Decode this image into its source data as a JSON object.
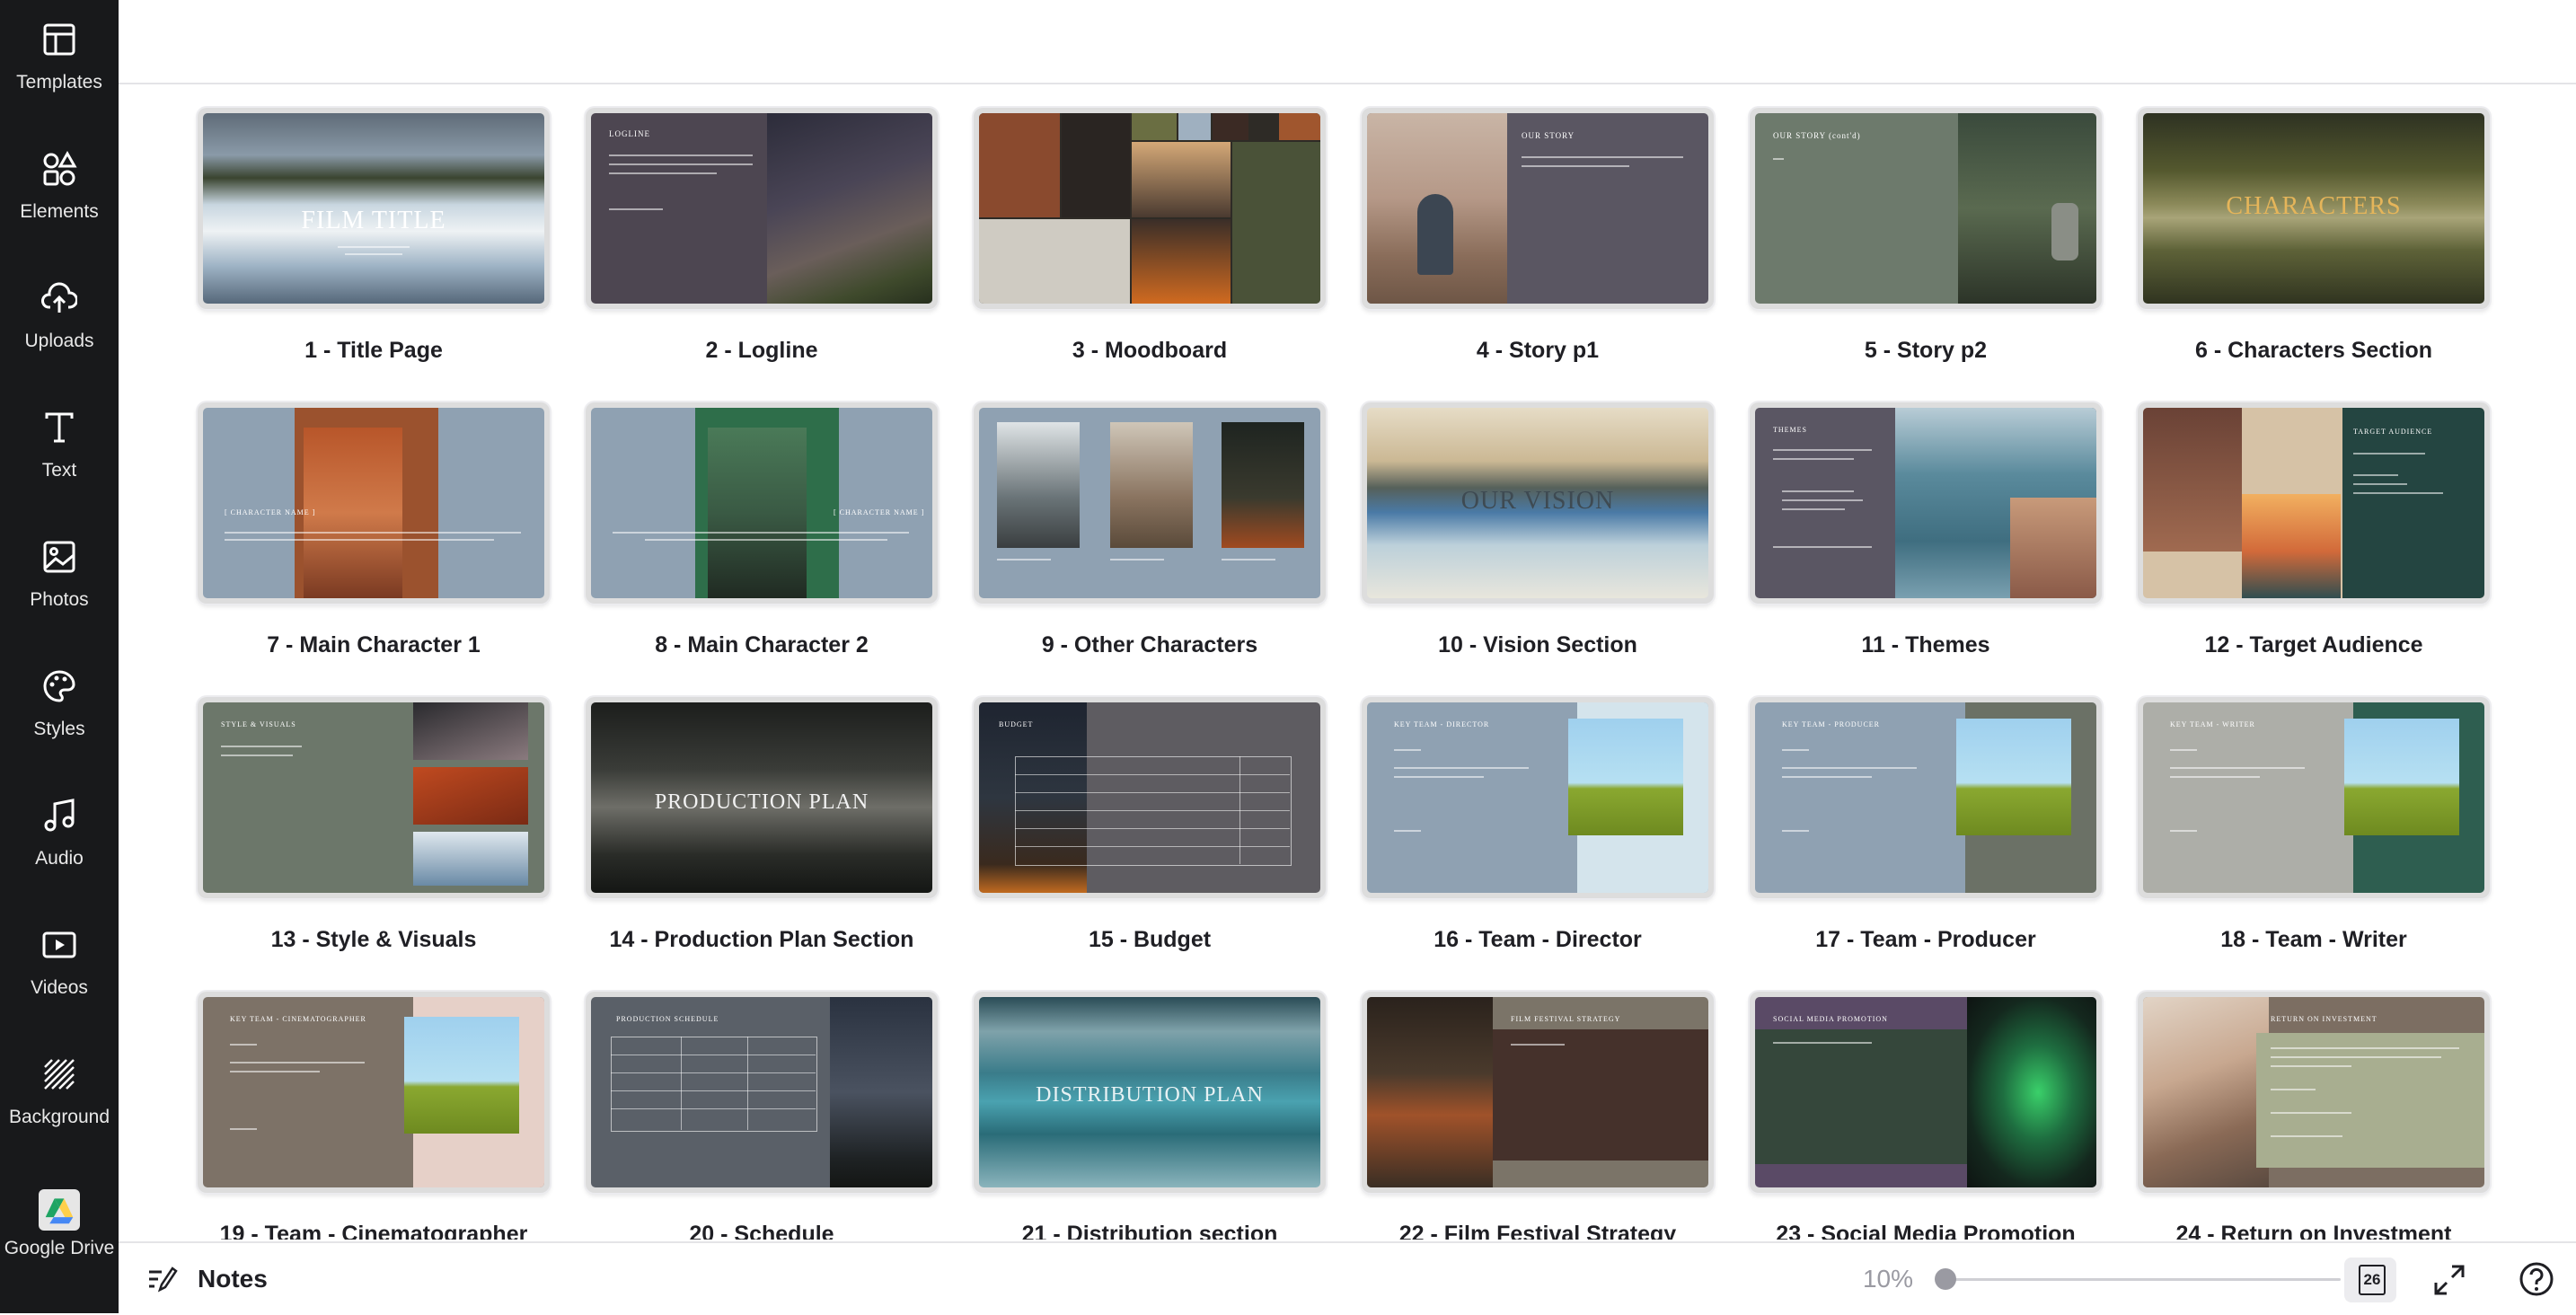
{
  "sidebar": {
    "items": [
      {
        "label": "Templates",
        "icon": "templates-icon"
      },
      {
        "label": "Elements",
        "icon": "elements-icon"
      },
      {
        "label": "Uploads",
        "icon": "upload-icon"
      },
      {
        "label": "Text",
        "icon": "text-icon"
      },
      {
        "label": "Photos",
        "icon": "photos-icon"
      },
      {
        "label": "Styles",
        "icon": "palette-icon"
      },
      {
        "label": "Audio",
        "icon": "music-note-icon"
      },
      {
        "label": "Videos",
        "icon": "video-icon"
      },
      {
        "label": "Background",
        "icon": "background-pattern-icon"
      },
      {
        "label": "Google Drive",
        "icon": "google-drive-icon"
      }
    ]
  },
  "pages": [
    {
      "label": "1 - Title Page",
      "thumb_text": "FILM TITLE"
    },
    {
      "label": "2 - Logline",
      "thumb_text": "LOGLINE"
    },
    {
      "label": "3 - Moodboard",
      "thumb_text": ""
    },
    {
      "label": "4 - Story p1",
      "thumb_text": "OUR STORY"
    },
    {
      "label": "5 - Story p2",
      "thumb_text": "OUR STORY (cont'd)"
    },
    {
      "label": "6 - Characters Section",
      "thumb_text": "CHARACTERS"
    },
    {
      "label": "7 - Main Character 1",
      "thumb_text": "[ CHARACTER NAME ]"
    },
    {
      "label": "8 - Main Character 2",
      "thumb_text": "[ CHARACTER NAME ]"
    },
    {
      "label": "9 - Other Characters",
      "thumb_text": ""
    },
    {
      "label": "10 - Vision Section",
      "thumb_text": "OUR VISION"
    },
    {
      "label": "11 - Themes",
      "thumb_text": "THEMES"
    },
    {
      "label": "12 - Target Audience",
      "thumb_text": "TARGET AUDIENCE"
    },
    {
      "label": "13 - Style & Visuals",
      "thumb_text": "STYLE & VISUALS"
    },
    {
      "label": "14 - Production Plan Section",
      "thumb_text": "PRODUCTION PLAN"
    },
    {
      "label": "15 - Budget",
      "thumb_text": "BUDGET"
    },
    {
      "label": "16 - Team - Director",
      "thumb_text": "KEY TEAM - DIRECTOR"
    },
    {
      "label": "17 - Team - Producer",
      "thumb_text": "KEY TEAM - PRODUCER"
    },
    {
      "label": "18 - Team - Writer",
      "thumb_text": "KEY TEAM - WRITER"
    },
    {
      "label": "19 - Team - Cinematographer",
      "thumb_text": "KEY TEAM - CINEMATOGRAPHER"
    },
    {
      "label": "20 - Schedule",
      "thumb_text": "PRODUCTION SCHEDULE"
    },
    {
      "label": "21 - Distribution section",
      "thumb_text": "DISTRIBUTION PLAN"
    },
    {
      "label": "22 - Film Festival Strategy",
      "thumb_text": "FILM FESTIVAL STRATEGY"
    },
    {
      "label": "23 - Social Media Promotion",
      "thumb_text": "SOCIAL MEDIA PROMOTION"
    },
    {
      "label": "24 - Return on Investment",
      "thumb_text": "RETURN ON INVESTMENT"
    }
  ],
  "bottombar": {
    "notes_label": "Notes",
    "zoom": "10%",
    "zoom_fraction": 0.1,
    "page_count": "26"
  }
}
